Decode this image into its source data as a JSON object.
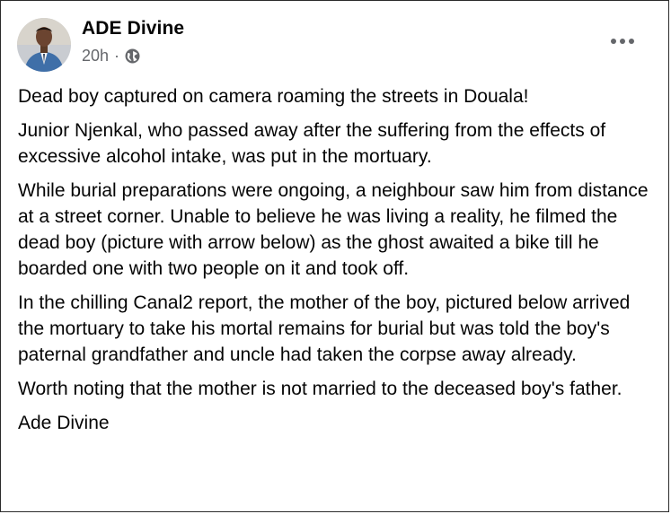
{
  "post": {
    "author": "ADE Divine",
    "time": "20h",
    "separator": "·",
    "audience_icon": "globe-icon",
    "more_icon": "more-options-icon",
    "paragraphs": [
      "Dead boy captured on camera roaming the streets in Douala!",
      "Junior Njenkal, who passed away after the suffering from the effects of excessive alcohol intake, was put in the mortuary.",
      "While burial preparations were ongoing, a neighbour saw him from distance at a street corner. Unable to believe he was living a reality, he filmed the dead boy (picture with arrow below) as the ghost awaited a bike till he boarded one with two people on it and took off.",
      "In the chilling Canal2 report, the mother of the boy, pictured below arrived the mortuary to take his mortal remains for burial but was told the boy's paternal grandfather and uncle had taken the corpse away already.",
      "Worth noting that the mother is not married to the deceased boy's father.",
      "Ade Divine"
    ]
  },
  "colors": {
    "text_primary": "#050505",
    "text_secondary": "#65676b",
    "border": "#2b2b2b"
  }
}
